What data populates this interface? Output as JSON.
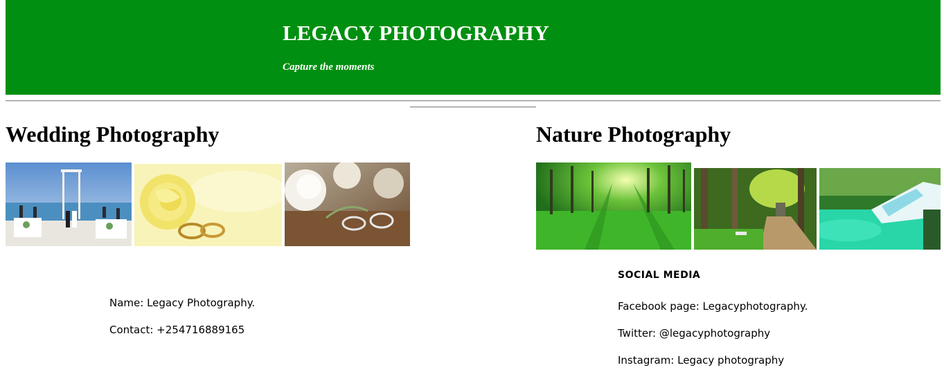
{
  "header": {
    "title": "LEGACY PHOTOGRAPHY",
    "tagline": "Capture the moments",
    "background_color": "#008f10"
  },
  "wedding": {
    "heading": "Wedding Photography",
    "photos": [
      "beach-wedding-ceremony-photo",
      "yellow-rose-rings-photo",
      "white-roses-rings-photo"
    ]
  },
  "nature": {
    "heading": "Nature Photography",
    "photos": [
      "sunlit-forest-meadow-photo",
      "forest-path-bench-photo",
      "turquoise-waterfall-photo"
    ]
  },
  "contact": {
    "name": "Name: Legacy Photography.",
    "phone": "Contact: +254716889165"
  },
  "social": {
    "heading": "SOCIAL MEDIA",
    "facebook": "Facebook page: Legacyphotography.",
    "twitter": "Twitter: @legacyphotography",
    "instagram": "Instagram: Legacy photography"
  }
}
